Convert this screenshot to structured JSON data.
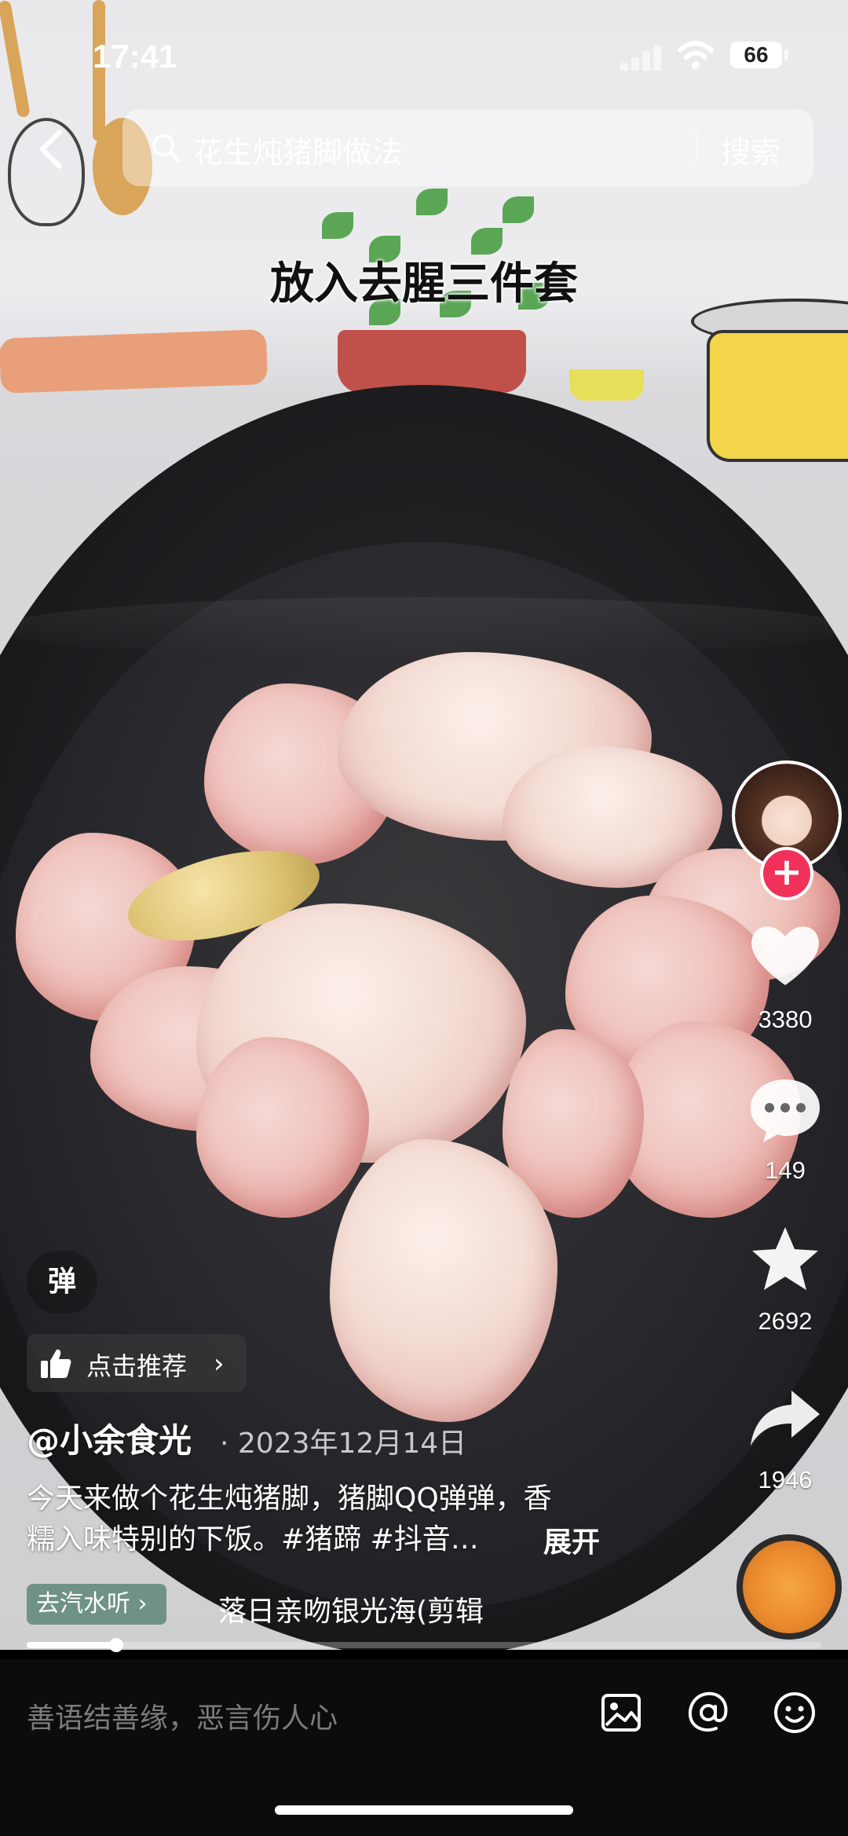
{
  "status_bar": {
    "time": "17:41",
    "battery": "66"
  },
  "search": {
    "query": "花生炖猪脚做法",
    "button": "搜索"
  },
  "video": {
    "caption": "放入去腥三件套"
  },
  "sidebar": {
    "likes": "3380",
    "comments": "149",
    "favorites": "2692",
    "shares": "1946",
    "follow_symbol": "+"
  },
  "info": {
    "danmu": "弹",
    "recommend_label": "点击推荐",
    "recommend_chevron": "›",
    "author": "@小余食光",
    "date": "· 2023年12月14日",
    "description_line1": "今天来做个花生炖猪脚，猪脚QQ弹弹，香",
    "description_line2": "糯入味特别的下饭。#猪蹄 #抖音…",
    "expand": "展开",
    "music_tag": "去汽水听 ›",
    "music_title": "落日亲吻银光海(剪辑"
  },
  "progress": {
    "fraction": 0.113
  },
  "comment_bar": {
    "placeholder": "善语结善缘，恶言伤人心"
  },
  "colors": {
    "accent_red": "#f2315b",
    "bg_dark": "#0c0c0c"
  },
  "icons": [
    "back-icon",
    "search-icon",
    "heart-icon",
    "comment-icon",
    "star-icon",
    "share-icon",
    "thumb-up-icon",
    "image-icon",
    "at-icon",
    "emoji-icon"
  ]
}
